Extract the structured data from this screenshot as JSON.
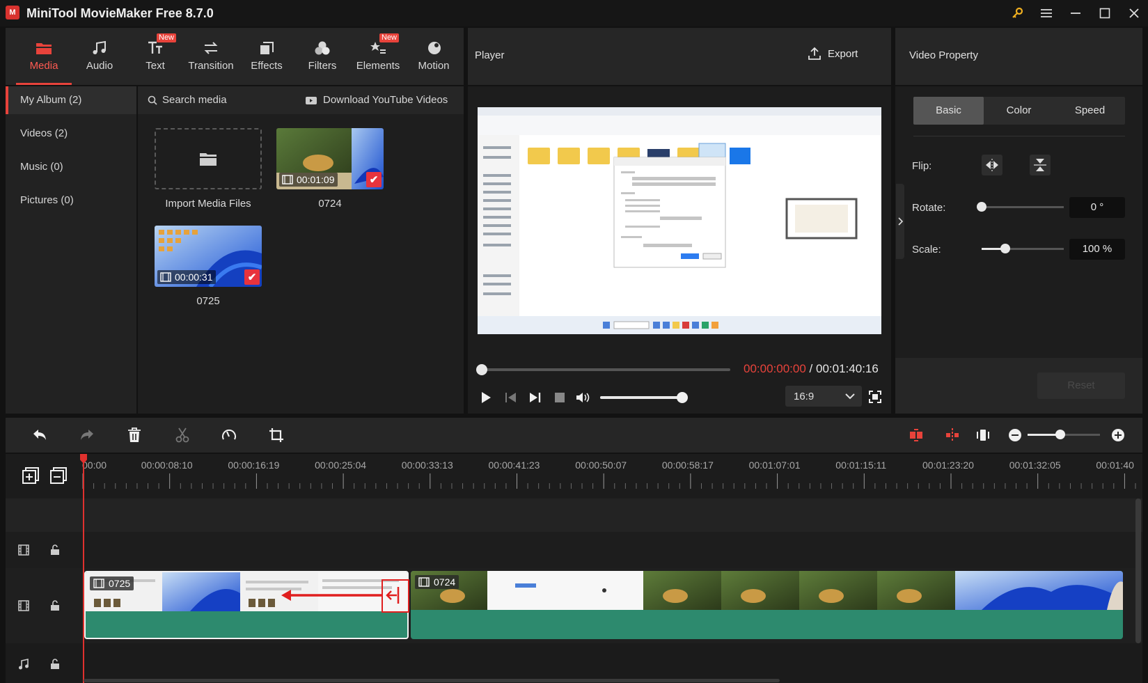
{
  "app": {
    "title": "MiniTool MovieMaker Free 8.7.0",
    "logo_text": "M"
  },
  "nav": [
    {
      "label": "Media",
      "icon": "folder-icon",
      "active": true
    },
    {
      "label": "Audio",
      "icon": "music-note-icon"
    },
    {
      "label": "Text",
      "icon": "text-icon",
      "badge": "New"
    },
    {
      "label": "Transition",
      "icon": "transition-arrows-icon"
    },
    {
      "label": "Effects",
      "icon": "effects-icon"
    },
    {
      "label": "Filters",
      "icon": "filters-icon"
    },
    {
      "label": "Elements",
      "icon": "elements-icon",
      "badge": "New"
    },
    {
      "label": "Motion",
      "icon": "motion-icon"
    }
  ],
  "album": [
    {
      "label": "My Album  (2)",
      "active": true
    },
    {
      "label": "Videos  (2)"
    },
    {
      "label": "Music  (0)"
    },
    {
      "label": "Pictures  (0)"
    }
  ],
  "media": {
    "search_placeholder": "Search media",
    "download_label": "Download YouTube Videos",
    "import_label": "Import Media Files",
    "cards": [
      {
        "name": "0724",
        "duration": "00:01:09"
      },
      {
        "name": "0725",
        "duration": "00:00:31"
      }
    ]
  },
  "player": {
    "title": "Player",
    "export_label": "Export",
    "current_time": "00:00:00:00",
    "separator": "/",
    "total_time": "00:01:40:16",
    "aspect": "16:9",
    "progress": 0,
    "volume": 1.0
  },
  "property": {
    "title": "Video Property",
    "tabs": [
      "Basic",
      "Color",
      "Speed"
    ],
    "active_tab": "Basic",
    "flip_label": "Flip:",
    "rotate_label": "Rotate:",
    "rotate_value": "0 °",
    "rotate_level": 0,
    "scale_label": "Scale:",
    "scale_value": "100 %",
    "scale_level": 0.29,
    "reset_label": "Reset"
  },
  "timeline": {
    "ruler": [
      "00:00",
      "00:00:08:10",
      "00:00:16:19",
      "00:00:25:04",
      "00:00:33:13",
      "00:00:41:23",
      "00:00:50:07",
      "00:00:58:17",
      "00:01:07:01",
      "00:01:15:11",
      "00:01:23:20",
      "00:01:32:05",
      "00:01:40"
    ],
    "clips": [
      {
        "name": "0725"
      },
      {
        "name": "0724"
      }
    ],
    "zoom_level": 0.45
  },
  "colors": {
    "accent": "#e8433b",
    "clip_audio": "#2d8a6e",
    "playhead": "#e0312e"
  }
}
